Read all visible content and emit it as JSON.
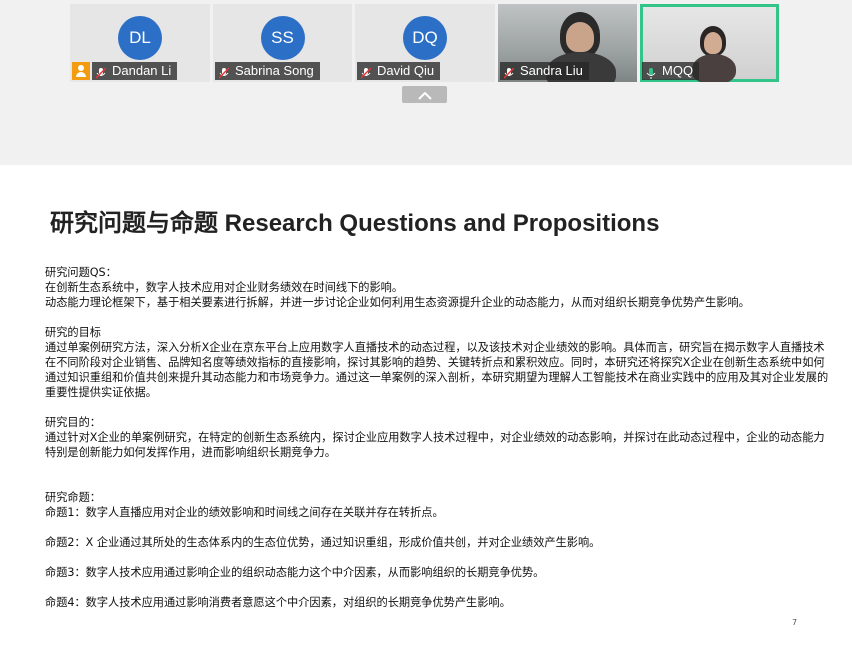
{
  "participants": [
    {
      "initials": "DL",
      "name": "Dandan Li",
      "host": true
    },
    {
      "initials": "SS",
      "name": "Sabrina Song",
      "host": false
    },
    {
      "initials": "DQ",
      "name": "David Qiu",
      "host": false
    },
    {
      "initials": "",
      "name": "Sandra Liu",
      "host": false
    },
    {
      "initials": "",
      "name": "MQQ",
      "host": false
    }
  ],
  "colors": {
    "avatar": "#2c6fc7",
    "active_speaker": "#33c48a",
    "host_badge": "#f39c12"
  },
  "slide": {
    "title": "研究问题与命题 Research Questions and Propositions",
    "qs_heading": "研究问题QS：",
    "qs_line1": "在创新生态系统中，数字人技术应用对企业财务绩效在时间线下的影响。",
    "qs_line2": "动态能力理论框架下，基于相关要素进行拆解，并进一步讨论企业如何利用生态资源提升企业的动态能力，从而对组织长期竞争优势产生影响。",
    "goal_heading": "研究的目标",
    "goal_text": "通过单案例研究方法，深入分析X企业在京东平台上应用数字人直播技术的动态过程，以及该技术对企业绩效的影响。具体而言，研究旨在揭示数字人直播技术在不同阶段对企业销售、品牌知名度等绩效指标的直接影响，探讨其影响的趋势、关键转折点和累积效应。同时，本研究还将探究X企业在创新生态系统中如何通过知识重组和价值共创来提升其动态能力和市场竞争力。通过这一单案例的深入剖析，本研究期望为理解人工智能技术在商业实践中的应用及其对企业发展的重要性提供实证依据。",
    "purpose_heading": "研究目的：",
    "purpose_text": "通过针对X企业的单案例研究，在特定的创新生态系统内，探讨企业应用数字人技术过程中，对企业绩效的动态影响，并探讨在此动态过程中，企业的动态能力特别是创新能力如何发挥作用，进而影响组织长期竞争力。",
    "prop_heading": "研究命题：",
    "prop1": "命题1：数字人直播应用对企业的绩效影响和时间线之间存在关联并存在转折点。",
    "prop2": "命题2：X 企业通过其所处的生态体系内的生态位优势，通过知识重组，形成价值共创，并对企业绩效产生影响。",
    "prop3": "命题3：数字人技术应用通过影响企业的组织动态能力这个中介因素，从而影响组织的长期竞争优势。",
    "prop4": "命题4：数字人技术应用通过影响消费者意愿这个中介因素，对组织的长期竞争优势产生影响。",
    "page_number": "7"
  }
}
